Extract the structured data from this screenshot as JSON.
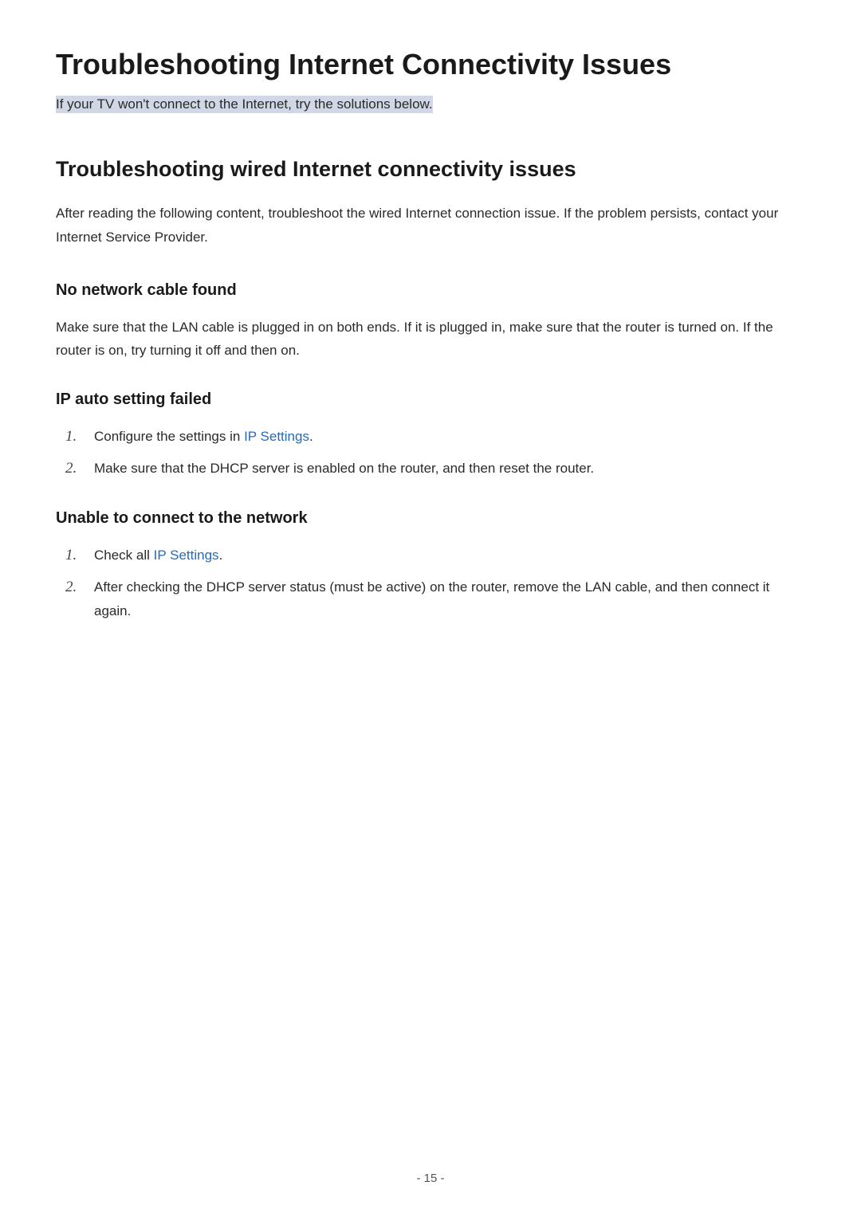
{
  "pageTitle": "Troubleshooting Internet Connectivity Issues",
  "subtitle": "If your TV won't connect to the Internet, try the solutions below.",
  "section": {
    "heading": "Troubleshooting wired Internet connectivity issues",
    "intro": "After reading the following content, troubleshoot the wired Internet connection issue. If the problem persists, contact your Internet Service Provider."
  },
  "subsections": [
    {
      "heading": "No network cable found",
      "body": "Make sure that the LAN cable is plugged in on both ends. If it is plugged in, make sure that the router is turned on. If the router is on, try turning it off and then on."
    },
    {
      "heading": "IP auto setting failed",
      "items": [
        {
          "marker": "1.",
          "textPrefix": "Configure the settings in ",
          "link": "IP Settings",
          "textSuffix": "."
        },
        {
          "marker": "2.",
          "textPlain": "Make sure that the DHCP server is enabled on the router, and then reset the router."
        }
      ]
    },
    {
      "heading": "Unable to connect to the network",
      "items": [
        {
          "marker": "1.",
          "textPrefix": "Check all ",
          "link": "IP Settings",
          "textSuffix": "."
        },
        {
          "marker": "2.",
          "textPlain": "After checking the DHCP server status (must be active) on the router, remove the LAN cable, and then connect it again."
        }
      ]
    }
  ],
  "pageNumber": "- 15 -"
}
